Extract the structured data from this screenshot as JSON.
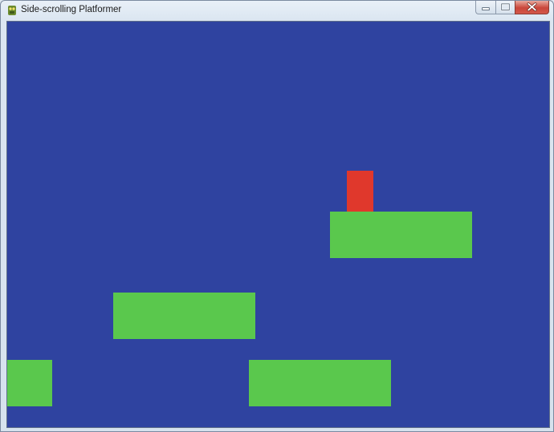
{
  "window": {
    "title": "Side-scrolling Platformer",
    "icons": {
      "app": "python-snake-icon",
      "minimize": "minimize-icon",
      "maximize": "maximize-icon",
      "close": "close-icon"
    }
  },
  "game": {
    "background_color": "#2f43a0",
    "platform_color": "#5ac84d",
    "player_color": "#e0382c",
    "platform_count": 4,
    "player_count": 1
  }
}
